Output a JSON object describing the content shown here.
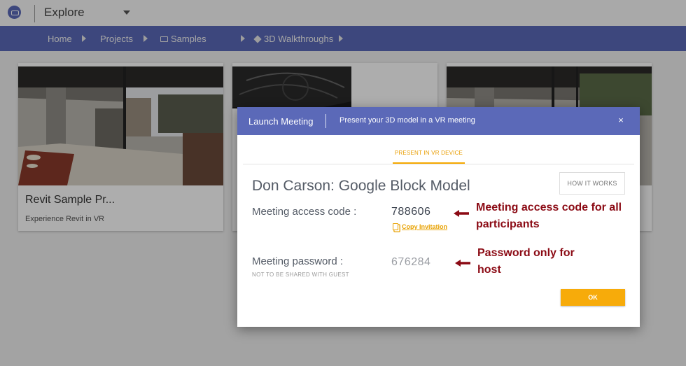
{
  "topbar": {
    "section_label": "Explore"
  },
  "breadcrumb": {
    "items": [
      {
        "label": "Home"
      },
      {
        "label": "Projects"
      },
      {
        "label": "Samples"
      },
      {
        "label": "3D Walkthroughs"
      }
    ]
  },
  "cards": [
    {
      "title": "Revit Sample Pr...",
      "subtitle": "Experience Revit in VR"
    },
    {
      "title": "",
      "subtitle": ""
    },
    {
      "title": "",
      "subtitle": ""
    }
  ],
  "modal": {
    "title": "Launch Meeting",
    "subtitle": "Present your 3D model in a VR meeting",
    "close_glyph": "×",
    "tab_label": "PRESENT IN VR DEVICE",
    "model_name": "Don Carson: Google Block Model",
    "how_it_works_label": "HOW IT WORKS",
    "access_code_label": "Meeting access code :",
    "access_code": "788606",
    "copy_label": "Copy Invitation",
    "password_label": "Meeting password :",
    "password_note": "NOT TO BE SHARED WITH GUEST",
    "password": "676284",
    "ok_label": "OK"
  },
  "annotations": {
    "access_line1": "Meeting access code for all",
    "access_line2": "participants",
    "password_line1": "Password only for",
    "password_line2": "host"
  },
  "colors": {
    "brand_blue": "#5b69b8",
    "accent_orange": "#f7ab0a",
    "annotation_red": "#8b0a14"
  }
}
